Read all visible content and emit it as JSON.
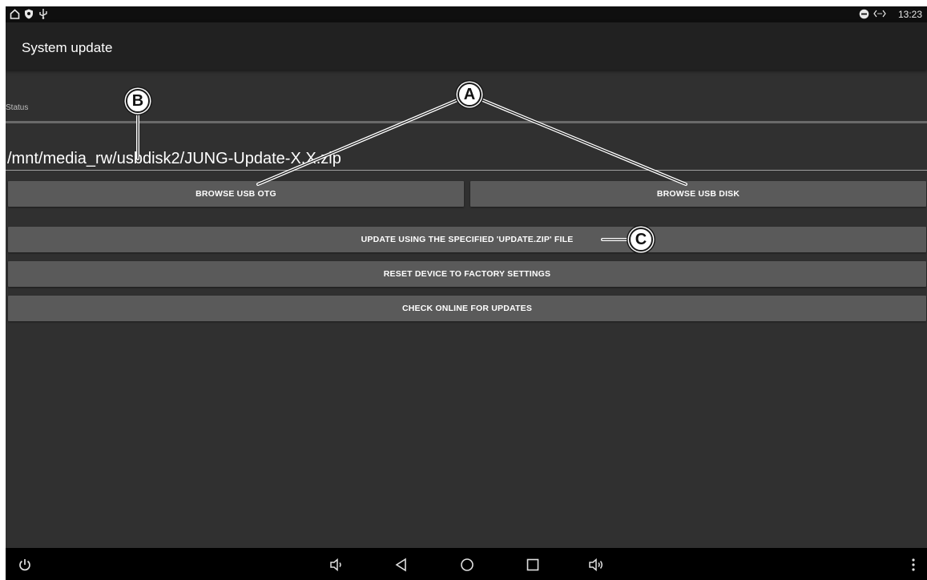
{
  "status_bar": {
    "time": "13:23",
    "left_icons": [
      "home-outline-icon",
      "shield-icon",
      "usb-icon"
    ],
    "right_icons": [
      "do-not-disturb-icon",
      "data-sync-icon"
    ]
  },
  "app_bar": {
    "title": "System update"
  },
  "status": {
    "label": "Status",
    "path": "/mnt/media_rw/usbdisk2/JUNG-Update-X.X.zip"
  },
  "buttons": {
    "browse_usb_otg": "BROWSE USB OTG",
    "browse_usb_disk": "BROWSE USB DISK",
    "update_zip": "UPDATE USING THE SPECIFIED 'UPDATE.ZIP' FILE",
    "factory_reset": "RESET DEVICE TO FACTORY SETTINGS",
    "check_online": "CHECK ONLINE FOR UPDATES"
  },
  "nav_bar": {
    "icons": [
      "power-icon",
      "volume-down-icon",
      "back-icon",
      "home-icon",
      "recents-icon",
      "volume-up-icon",
      "more-vert-icon"
    ]
  },
  "callouts": {
    "a": "A",
    "b": "B",
    "c": "C"
  },
  "colors": {
    "background": "#303030",
    "app_bar": "#212121",
    "button": "#5a5a5a",
    "status_bar": "#0f0f0f",
    "nav_bar": "#000000"
  }
}
